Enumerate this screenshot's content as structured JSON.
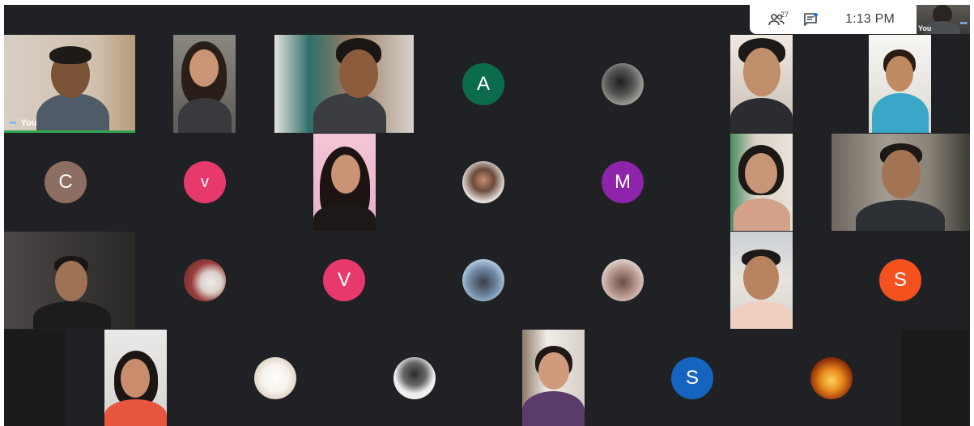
{
  "topbar": {
    "people_count": "27",
    "time": "1:13 PM",
    "self_label": "You"
  },
  "self_tile": {
    "name": "You"
  },
  "letter_avatars": [
    {
      "letter": "A",
      "color": "#0b6b4d"
    },
    {
      "letter": "C",
      "color": "#8d6e63"
    },
    {
      "letter": "V",
      "color": "#e8396d"
    },
    {
      "letter": "M",
      "color": "#8e24aa"
    },
    {
      "letter": "V",
      "color": "#e8396d"
    },
    {
      "letter": "S",
      "color": "#f4511e"
    },
    {
      "letter": "S",
      "color": "#1565c0"
    }
  ],
  "colors": {
    "stage_bg": "#202124",
    "active_speaker": "#34a853",
    "accent": "#8ab4f8"
  }
}
